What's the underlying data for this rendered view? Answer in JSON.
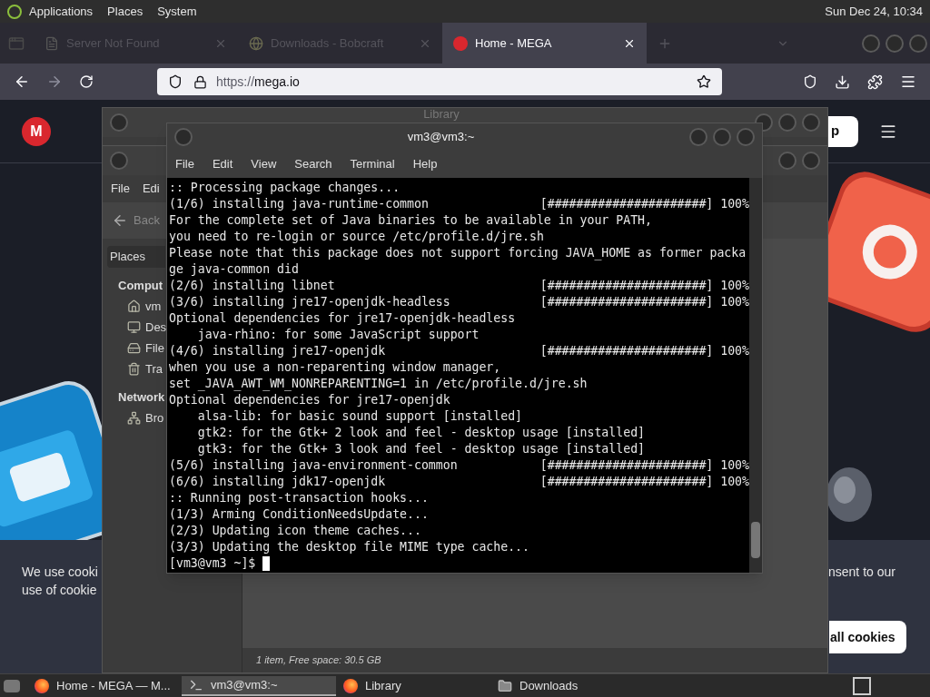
{
  "top_panel": {
    "menus": [
      "Applications",
      "Places",
      "System"
    ],
    "clock": "Sun Dec 24, 10:34"
  },
  "browser": {
    "tabs": [
      {
        "title": "Server Not Found",
        "kind": "page",
        "selected": false
      },
      {
        "title": "Downloads - Bobcraft",
        "kind": "site",
        "selected": false
      },
      {
        "title": "Home - MEGA",
        "kind": "mega",
        "selected": true
      }
    ],
    "url": {
      "scheme": "https://",
      "host": "mega.io"
    },
    "page": {
      "logo": "M",
      "header_button": "p",
      "cookie_banner": {
        "text_left": "We use cooki",
        "text_left_2": "use of cookie",
        "text_right": "nsent to our",
        "button": "all cookies"
      }
    }
  },
  "library_window": {
    "title": "Library"
  },
  "file_manager": {
    "menus": [
      "File",
      "Edi"
    ],
    "back": "Back",
    "sidebar_header": "Places",
    "sections": [
      {
        "title": "Comput",
        "items": [
          {
            "label": "vm",
            "kind": "home"
          },
          {
            "label": "Des",
            "kind": "desktop"
          },
          {
            "label": "File",
            "kind": "drive"
          },
          {
            "label": "Tra",
            "kind": "trash"
          }
        ]
      },
      {
        "title": "Network",
        "items": [
          {
            "label": "Bro",
            "kind": "network"
          }
        ]
      }
    ],
    "status": "1 item, Free space: 30.5 GB"
  },
  "terminal": {
    "title": "vm3@vm3:~",
    "menus": [
      "File",
      "Edit",
      "View",
      "Search",
      "Terminal",
      "Help"
    ],
    "lines": [
      {
        "text": ":: Processing package changes..."
      },
      {
        "text": "(1/6) installing java-runtime-common",
        "bar": "[######################] 100%"
      },
      {
        "text": "For the complete set of Java binaries to be available in your PATH,"
      },
      {
        "text": "you need to re-login or source /etc/profile.d/jre.sh"
      },
      {
        "text": "Please note that this package does not support forcing JAVA_HOME as former packa"
      },
      {
        "text": "ge java-common did"
      },
      {
        "text": "(2/6) installing libnet",
        "bar": "[######################] 100%"
      },
      {
        "text": "(3/6) installing jre17-openjdk-headless",
        "bar": "[######################] 100%"
      },
      {
        "text": "Optional dependencies for jre17-openjdk-headless"
      },
      {
        "text": "    java-rhino: for some JavaScript support"
      },
      {
        "text": "(4/6) installing jre17-openjdk",
        "bar": "[######################] 100%"
      },
      {
        "text": "when you use a non-reparenting window manager,"
      },
      {
        "text": "set _JAVA_AWT_WM_NONREPARENTING=1 in /etc/profile.d/jre.sh"
      },
      {
        "text": "Optional dependencies for jre17-openjdk"
      },
      {
        "text": "    alsa-lib: for basic sound support [installed]"
      },
      {
        "text": "    gtk2: for the Gtk+ 2 look and feel - desktop usage [installed]"
      },
      {
        "text": "    gtk3: for the Gtk+ 3 look and feel - desktop usage [installed]"
      },
      {
        "text": "(5/6) installing java-environment-common",
        "bar": "[######################] 100%"
      },
      {
        "text": "(6/6) installing jdk17-openjdk",
        "bar": "[######################] 100%"
      },
      {
        "text": ":: Running post-transaction hooks..."
      },
      {
        "text": "(1/3) Arming ConditionNeedsUpdate..."
      },
      {
        "text": "(2/3) Updating icon theme caches..."
      },
      {
        "text": "(3/3) Updating the desktop file MIME type cache..."
      }
    ],
    "prompt": "[vm3@vm3 ~]$"
  },
  "taskbar": {
    "items": [
      {
        "label": "Home - MEGA — M...",
        "kind": "firefox",
        "selected": false
      },
      {
        "label": "vm3@vm3:~",
        "kind": "terminal",
        "selected": true
      },
      {
        "label": "Library",
        "kind": "firefox",
        "selected": false
      },
      {
        "label": "Downloads",
        "kind": "folder",
        "selected": false
      }
    ]
  }
}
